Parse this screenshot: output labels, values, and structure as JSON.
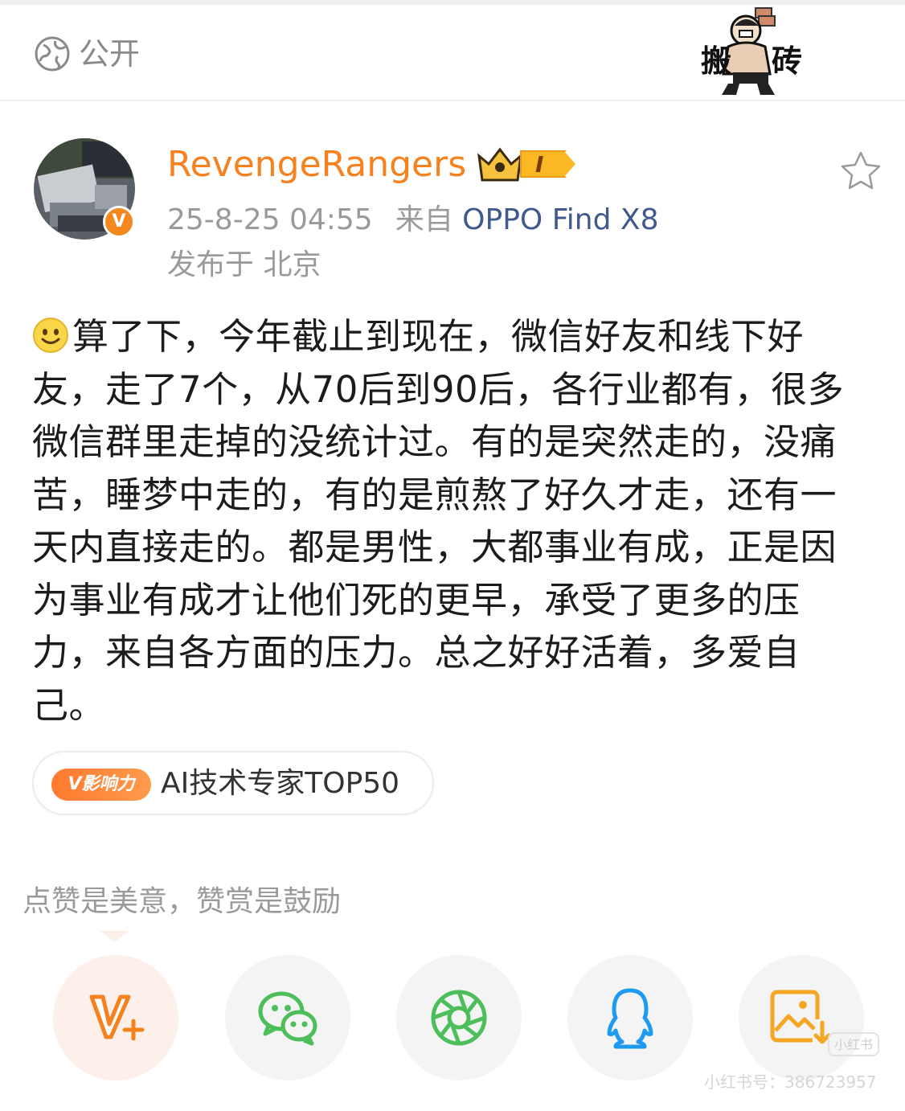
{
  "header": {
    "visibility_label": "公开",
    "sticker_text_left": "搬",
    "sticker_text_right": "砖"
  },
  "post": {
    "username": "RevengeRangers",
    "level_badge": "I",
    "avatar_badge": "V",
    "time": "25-8-25 04:55",
    "source_prefix": "来自",
    "device": "OPPO Find X8",
    "location": "发布于 北京",
    "body": "算了下，今年截止到现在，微信好友和线下好友，走了7个，从70后到90后，各行业都有，很多微信群里走掉的没统计过。有的是突然走的，没痛苦，睡梦中走的，有的是煎熬了好久才走，还有一天内直接走的。都是男性，大都事业有成，正是因为事业有成才让他们死的更早，承受了更多的压力，来自各方面的压力。总之好好活着，多爱自己。"
  },
  "influence": {
    "badge": "V影响力",
    "text": "AI技术专家TOP50"
  },
  "reward": {
    "label": "点赞是美意，赞赏是鼓励"
  },
  "share": {
    "buttons": [
      "v-plus-icon",
      "wechat-icon",
      "moments-icon",
      "qq-icon",
      "save-image-icon"
    ]
  },
  "watermark": {
    "logo": "小红书",
    "text": "小红书号：386723957"
  },
  "colors": {
    "username": "#f5821f",
    "device_link": "#41598c",
    "muted": "#9a9a9a",
    "wechat_green": "#4cbf5a",
    "qq_blue": "#1e9bf0",
    "save_orange": "#f5a623"
  }
}
